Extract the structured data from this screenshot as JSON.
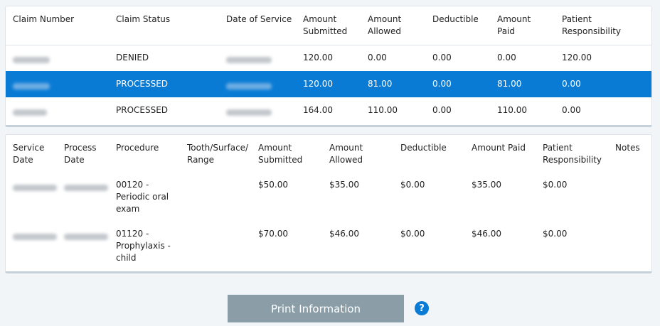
{
  "claims_table": {
    "headers": [
      "Claim Number",
      "Claim Status",
      "Date of Service",
      "Amount Submitted",
      "Amount Allowed",
      "Deductible",
      "Amount Paid",
      "Patient Responsibility"
    ],
    "rows": [
      {
        "status": "DENIED",
        "submitted": "120.00",
        "allowed": "0.00",
        "deductible": "0.00",
        "paid": "0.00",
        "patient_resp": "120.00"
      },
      {
        "status": "PROCESSED",
        "submitted": "120.00",
        "allowed": "81.00",
        "deductible": "0.00",
        "paid": "81.00",
        "patient_resp": "0.00"
      },
      {
        "status": "PROCESSED",
        "submitted": "164.00",
        "allowed": "110.00",
        "deductible": "0.00",
        "paid": "110.00",
        "patient_resp": "0.00"
      }
    ],
    "selected_row_index": 1,
    "selected_color": "#0a7bd4"
  },
  "details_table": {
    "headers": [
      "Service Date",
      "Process Date",
      "Procedure",
      "Tooth/Surface/ Range",
      "Amount Submitted",
      "Amount Allowed",
      "Deductible",
      "Amount Paid",
      "Patient Responsibility",
      "Notes"
    ],
    "rows": [
      {
        "procedure": "00120 - Periodic oral exam",
        "submitted": "$50.00",
        "allowed": "$35.00",
        "deductible": "$0.00",
        "paid": "$35.00",
        "patient_resp": "$0.00"
      },
      {
        "procedure": "01120 - Prophylaxis - child",
        "submitted": "$70.00",
        "allowed": "$46.00",
        "deductible": "$0.00",
        "paid": "$46.00",
        "patient_resp": "$0.00"
      }
    ]
  },
  "footer": {
    "print_label": "Print Information",
    "help_icon": "question-circle-icon",
    "help_glyph": "?"
  }
}
